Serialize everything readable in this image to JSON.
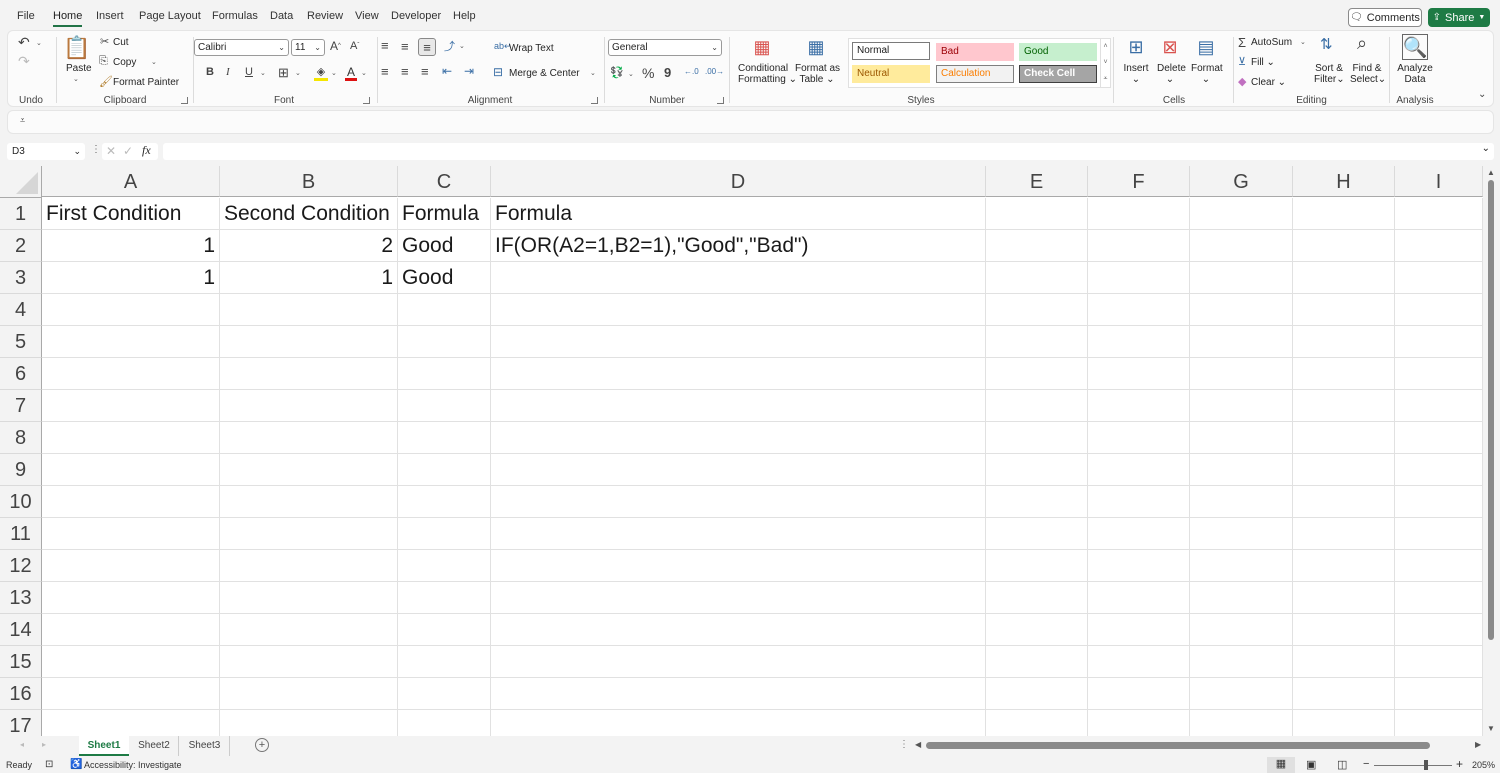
{
  "menu": {
    "tabs": [
      "File",
      "Home",
      "Insert",
      "Page Layout",
      "Formulas",
      "Data",
      "Review",
      "View",
      "Developer",
      "Help"
    ],
    "active": "Home",
    "comments_label": "Comments",
    "share_label": "Share"
  },
  "ribbon": {
    "undo": {
      "group_label": "Undo"
    },
    "clipboard": {
      "paste": "Paste",
      "cut": "Cut",
      "copy": "Copy",
      "format_painter": "Format Painter",
      "group_label": "Clipboard"
    },
    "font": {
      "font_name": "Calibri",
      "font_size": "11",
      "bold": "B",
      "italic": "I",
      "underline": "U",
      "group_label": "Font"
    },
    "alignment": {
      "wrap_text": "Wrap Text",
      "merge_center": "Merge & Center",
      "group_label": "Alignment"
    },
    "number": {
      "format": "General",
      "percent": "%",
      "comma": "9",
      "group_label": "Number"
    },
    "styles": {
      "conditional_formatting": [
        "Conditional",
        "Formatting"
      ],
      "format_as_table": [
        "Format as",
        "Table"
      ],
      "cells": [
        {
          "label": "Normal",
          "bg": "#ffffff",
          "fg": "#1a1a1a",
          "border": "#7a7a7a"
        },
        {
          "label": "Bad",
          "bg": "#ffc7ce",
          "fg": "#9c0006",
          "border": "#ffc7ce"
        },
        {
          "label": "Good",
          "bg": "#c6efce",
          "fg": "#006100",
          "border": "#c6efce"
        },
        {
          "label": "Neutral",
          "bg": "#ffeb9c",
          "fg": "#9c5700",
          "border": "#ffeb9c"
        },
        {
          "label": "Calculation",
          "bg": "#f2f2f2",
          "fg": "#fa7d00",
          "border": "#7f7f7f"
        },
        {
          "label": "Check Cell",
          "bg": "#a5a5a5",
          "fg": "#ffffff",
          "border": "#3f3f3f"
        }
      ],
      "group_label": "Styles"
    },
    "cells": {
      "insert": "Insert",
      "delete": "Delete",
      "format": "Format",
      "group_label": "Cells"
    },
    "editing": {
      "autosum": "AutoSum",
      "fill": "Fill",
      "clear": "Clear",
      "sort_filter": [
        "Sort &",
        "Filter"
      ],
      "find_select": [
        "Find &",
        "Select"
      ],
      "group_label": "Editing"
    },
    "analysis": {
      "analyze_data": [
        "Analyze",
        "Data"
      ],
      "group_label": "Analysis"
    }
  },
  "formula_bar": {
    "name_box": "D3",
    "fx": "fx",
    "content": ""
  },
  "sheet": {
    "columns": [
      "A",
      "B",
      "C",
      "D",
      "E",
      "F",
      "G",
      "H",
      "I"
    ],
    "rows": [
      "1",
      "2",
      "3",
      "4",
      "5",
      "6",
      "7",
      "8",
      "9",
      "10",
      "11",
      "12",
      "13",
      "14",
      "15",
      "16",
      "17"
    ],
    "cells": {
      "A1": "First Condition",
      "B1": "Second Condition",
      "C1": "Formula",
      "D1": "Formula",
      "A2": "1",
      "B2": "2",
      "C2": "Good",
      "D2": "IF(OR(A2=1,B2=1),\"Good\",\"Bad\")",
      "A3": "1",
      "B3": "1",
      "C3": "Good"
    }
  },
  "sheet_tabs": [
    "Sheet1",
    "Sheet2",
    "Sheet3"
  ],
  "active_sheet": "Sheet1",
  "status_bar": {
    "ready": "Ready",
    "accessibility": "Accessibility: Investigate",
    "zoom": "205%"
  }
}
